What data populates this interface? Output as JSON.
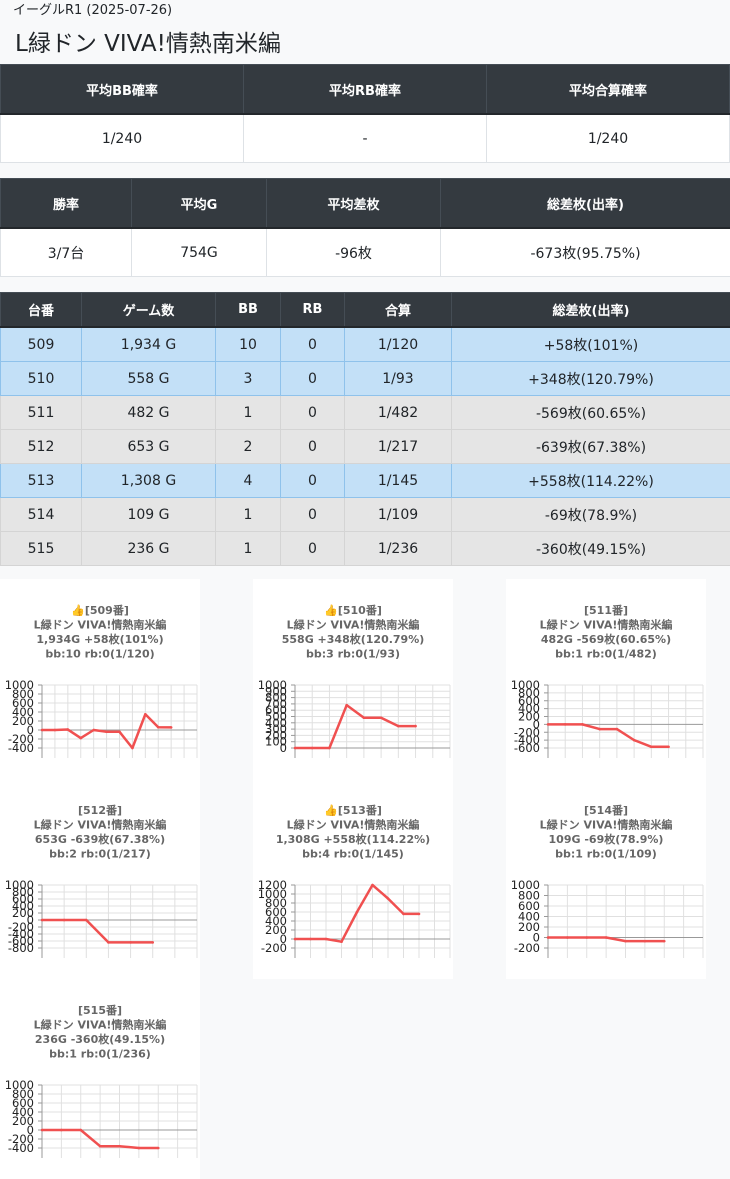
{
  "header": {
    "store": "イーグルR1 (2025-07-26)",
    "machine": "L緑ドン VIVA!情熱南米編"
  },
  "summary1": {
    "headers": [
      "平均BB確率",
      "平均RB確率",
      "平均合算確率"
    ],
    "values": [
      "1/240",
      "-",
      "1/240"
    ]
  },
  "summary2": {
    "headers": [
      "勝率",
      "平均G",
      "平均差枚",
      "総差枚(出率)"
    ],
    "values": [
      "3/7台",
      "754G",
      "-96枚",
      "-673枚(95.75%)"
    ]
  },
  "machines": {
    "headers": [
      "台番",
      "ゲーム数",
      "BB",
      "RB",
      "合算",
      "総差枚(出率)"
    ],
    "rows": [
      {
        "no": "509",
        "games": "1,934 G",
        "bb": "10",
        "rb": "0",
        "total": "1/120",
        "diff": "+58枚(101%)",
        "win": true
      },
      {
        "no": "510",
        "games": "558 G",
        "bb": "3",
        "rb": "0",
        "total": "1/93",
        "diff": "+348枚(120.79%)",
        "win": true
      },
      {
        "no": "511",
        "games": "482 G",
        "bb": "1",
        "rb": "0",
        "total": "1/482",
        "diff": "-569枚(60.65%)",
        "win": false
      },
      {
        "no": "512",
        "games": "653 G",
        "bb": "2",
        "rb": "0",
        "total": "1/217",
        "diff": "-639枚(67.38%)",
        "win": false
      },
      {
        "no": "513",
        "games": "1,308 G",
        "bb": "4",
        "rb": "0",
        "total": "1/145",
        "diff": "+558枚(114.22%)",
        "win": true
      },
      {
        "no": "514",
        "games": "109 G",
        "bb": "1",
        "rb": "0",
        "total": "1/109",
        "diff": "-69枚(78.9%)",
        "win": false
      },
      {
        "no": "515",
        "games": "236 G",
        "bb": "1",
        "rb": "0",
        "total": "1/236",
        "diff": "-360枚(49.15%)",
        "win": false
      }
    ]
  },
  "colors": {
    "line": "#f05050",
    "header_bg": "#343a40",
    "win_row": "#c3e0f7",
    "lose_row": "#e5e5e5"
  },
  "chart_data": [
    {
      "type": "line",
      "title": [
        "👍[509番]",
        "L緑ドン VIVA!情熱南米編",
        "1,934G +58枚(101%)",
        "bb:10 rb:0(1/120)"
      ],
      "yticks": [
        1000,
        800,
        600,
        400,
        200,
        0,
        -200,
        -400
      ],
      "ylim": [
        -400,
        1000
      ],
      "x": [
        0,
        1,
        2,
        3,
        4,
        5,
        6,
        7,
        8,
        9,
        10
      ],
      "y": [
        0,
        0,
        10,
        -180,
        0,
        -40,
        -40,
        -400,
        350,
        60,
        58
      ]
    },
    {
      "type": "line",
      "title": [
        "👍[510番]",
        "L緑ドン VIVA!情熱南米編",
        "558G +348枚(120.79%)",
        "bb:3 rb:0(1/93)"
      ],
      "yticks": [
        1000,
        900,
        800,
        700,
        600,
        500,
        400,
        300,
        200,
        100,
        0
      ],
      "ylim": [
        0,
        1000
      ],
      "x": [
        0,
        1,
        2,
        3,
        4,
        5,
        6,
        7
      ],
      "y": [
        0,
        0,
        0,
        680,
        480,
        480,
        348,
        348
      ]
    },
    {
      "type": "line",
      "title": [
        "[511番]",
        "L緑ドン VIVA!情熱南米編",
        "482G -569枚(60.65%)",
        "bb:1 rb:0(1/482)"
      ],
      "yticks": [
        1000,
        800,
        600,
        400,
        200,
        0,
        -200,
        -400,
        -600
      ],
      "ylim": [
        -600,
        1000
      ],
      "x": [
        0,
        1,
        2,
        3,
        4,
        5,
        6,
        7
      ],
      "y": [
        0,
        0,
        0,
        -120,
        -120,
        -400,
        -569,
        -569
      ]
    },
    {
      "type": "line",
      "title": [
        "[512番]",
        "L緑ドン VIVA!情熱南米編",
        "653G -639枚(67.38%)",
        "bb:2 rb:0(1/217)"
      ],
      "yticks": [
        1000,
        800,
        600,
        400,
        200,
        0,
        -200,
        -400,
        -600,
        -800
      ],
      "ylim": [
        -800,
        1000
      ],
      "x": [
        0,
        1,
        2,
        3,
        4,
        5
      ],
      "y": [
        0,
        0,
        0,
        -639,
        -639,
        -639
      ]
    },
    {
      "type": "line",
      "title": [
        "👍[513番]",
        "L緑ドン VIVA!情熱南米編",
        "1,308G +558枚(114.22%)",
        "bb:4 rb:0(1/145)"
      ],
      "yticks": [
        1200,
        1000,
        800,
        600,
        400,
        200,
        0,
        -200
      ],
      "ylim": [
        -200,
        1200
      ],
      "x": [
        0,
        1,
        2,
        3,
        4,
        5,
        6,
        7,
        8
      ],
      "y": [
        0,
        0,
        0,
        -60,
        600,
        1200,
        900,
        558,
        558
      ]
    },
    {
      "type": "line",
      "title": [
        "[514番]",
        "L緑ドン VIVA!情熱南米編",
        "109G -69枚(78.9%)",
        "bb:1 rb:0(1/109)"
      ],
      "yticks": [
        1000,
        800,
        600,
        400,
        200,
        0,
        -200
      ],
      "ylim": [
        -200,
        1000
      ],
      "x": [
        0,
        1,
        2,
        3,
        4,
        5,
        6
      ],
      "y": [
        0,
        0,
        0,
        0,
        -69,
        -69,
        -69
      ]
    },
    {
      "type": "line",
      "title": [
        "[515番]",
        "L緑ドン VIVA!情熱南米編",
        "236G -360枚(49.15%)",
        "bb:1 rb:0(1/236)"
      ],
      "yticks": [
        1000,
        800,
        600,
        400,
        200,
        0,
        -200,
        -400
      ],
      "ylim": [
        -400,
        1000
      ],
      "x": [
        0,
        1,
        2,
        3,
        4,
        5,
        6
      ],
      "y": [
        0,
        0,
        0,
        -360,
        -360,
        -400,
        -400
      ]
    }
  ]
}
